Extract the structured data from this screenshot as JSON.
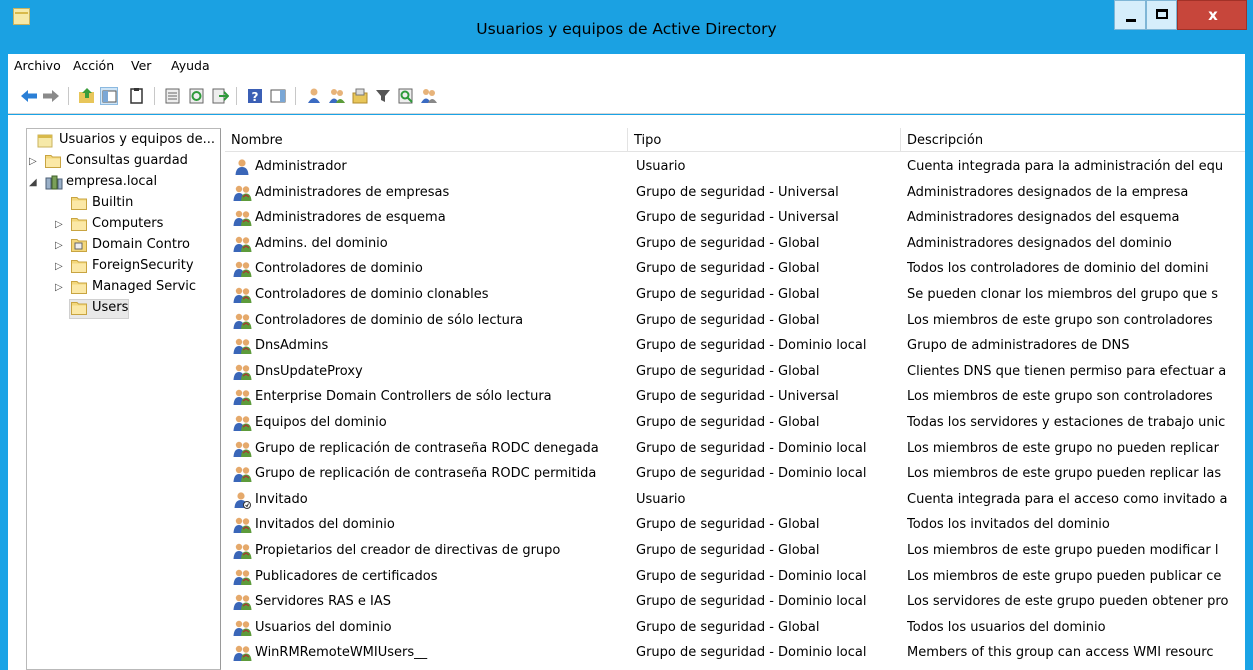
{
  "window": {
    "title": "Usuarios y equipos de Active Directory",
    "close_label": "x"
  },
  "menu": {
    "items": [
      "Archivo",
      "Acción",
      "Ver",
      "Ayuda"
    ]
  },
  "toolbar": {
    "icons": [
      "back-arrow-icon",
      "forward-arrow-icon",
      "up-folder-icon",
      "show-console-tree-icon",
      "clipboard-icon",
      "properties-icon",
      "refresh-icon",
      "export-list-icon",
      "help-icon",
      "show-hide-action-pane-icon",
      "new-user-icon",
      "new-group-icon",
      "new-ou-icon",
      "filter-icon",
      "find-icon",
      "add-to-group-icon"
    ]
  },
  "tree": {
    "root": "Usuarios y equipos de...",
    "items": [
      {
        "label": "Consultas guardad",
        "indent": 0,
        "expander": "collapsed",
        "icon": "folder-icon"
      },
      {
        "label": "empresa.local",
        "indent": 0,
        "expander": "expanded",
        "icon": "domain-icon"
      },
      {
        "label": "Builtin",
        "indent": 1,
        "expander": "none",
        "icon": "folder-icon"
      },
      {
        "label": "Computers",
        "indent": 1,
        "expander": "collapsed",
        "icon": "folder-icon"
      },
      {
        "label": "Domain Contro",
        "indent": 1,
        "expander": "collapsed",
        "icon": "ou-folder-icon"
      },
      {
        "label": "ForeignSecurity",
        "indent": 1,
        "expander": "collapsed",
        "icon": "folder-icon"
      },
      {
        "label": "Managed Servic",
        "indent": 1,
        "expander": "collapsed",
        "icon": "folder-icon"
      },
      {
        "label": "Users",
        "indent": 1,
        "expander": "none",
        "icon": "folder-icon",
        "selected": true
      }
    ]
  },
  "list": {
    "columns": [
      "Nombre",
      "Tipo",
      "Descripción"
    ],
    "rows": [
      {
        "name": "Administrador",
        "type": "Usuario",
        "desc": "Cuenta integrada para la administración del equ",
        "icon": "user-icon"
      },
      {
        "name": "Administradores de empresas",
        "type": "Grupo de seguridad - Universal",
        "desc": "Administradores designados de la empresa",
        "icon": "group-icon"
      },
      {
        "name": "Administradores de esquema",
        "type": "Grupo de seguridad - Universal",
        "desc": "Administradores designados del esquema",
        "icon": "group-icon"
      },
      {
        "name": "Admins. del dominio",
        "type": "Grupo de seguridad - Global",
        "desc": "Administradores designados del dominio",
        "icon": "group-icon"
      },
      {
        "name": "Controladores de dominio",
        "type": "Grupo de seguridad - Global",
        "desc": "Todos los controladores de dominio del domini",
        "icon": "group-icon"
      },
      {
        "name": "Controladores de dominio clonables",
        "type": "Grupo de seguridad - Global",
        "desc": "Se pueden clonar los miembros del grupo que s",
        "icon": "group-icon"
      },
      {
        "name": "Controladores de dominio de sólo lectura",
        "type": "Grupo de seguridad - Global",
        "desc": "Los miembros de este grupo son controladores",
        "icon": "group-icon"
      },
      {
        "name": "DnsAdmins",
        "type": "Grupo de seguridad - Dominio local",
        "desc": "Grupo de administradores de DNS",
        "icon": "group-icon"
      },
      {
        "name": "DnsUpdateProxy",
        "type": "Grupo de seguridad - Global",
        "desc": "Clientes DNS que tienen permiso para efectuar a",
        "icon": "group-icon"
      },
      {
        "name": "Enterprise Domain Controllers de sólo lectura",
        "type": "Grupo de seguridad - Universal",
        "desc": "Los miembros de este grupo son controladores",
        "icon": "group-icon"
      },
      {
        "name": "Equipos del dominio",
        "type": "Grupo de seguridad - Global",
        "desc": "Todas los servidores y estaciones de trabajo unic",
        "icon": "group-icon"
      },
      {
        "name": "Grupo de replicación de contraseña RODC denegada",
        "type": "Grupo de seguridad - Dominio local",
        "desc": "Los miembros de este grupo no pueden replicar",
        "icon": "group-icon"
      },
      {
        "name": "Grupo de replicación de contraseña RODC permitida",
        "type": "Grupo de seguridad - Dominio local",
        "desc": "Los miembros de este grupo pueden replicar las",
        "icon": "group-icon"
      },
      {
        "name": "Invitado",
        "type": "Usuario",
        "desc": "Cuenta integrada para el acceso como invitado a",
        "icon": "disabled-user-icon"
      },
      {
        "name": "Invitados del dominio",
        "type": "Grupo de seguridad - Global",
        "desc": "Todos los invitados del dominio",
        "icon": "group-icon"
      },
      {
        "name": "Propietarios del creador de directivas de grupo",
        "type": "Grupo de seguridad - Global",
        "desc": "Los miembros de este grupo pueden modificar l",
        "icon": "group-icon"
      },
      {
        "name": "Publicadores de certificados",
        "type": "Grupo de seguridad - Dominio local",
        "desc": "Los miembros de este grupo pueden publicar ce",
        "icon": "group-icon"
      },
      {
        "name": "Servidores RAS e IAS",
        "type": "Grupo de seguridad - Dominio local",
        "desc": "Los servidores de este grupo pueden obtener pro",
        "icon": "group-icon"
      },
      {
        "name": "Usuarios del dominio",
        "type": "Grupo de seguridad - Global",
        "desc": "Todos los usuarios del dominio",
        "icon": "group-icon"
      },
      {
        "name": "WinRMRemoteWMIUsers__",
        "type": "Grupo de seguridad - Dominio local",
        "desc": "Members of this group can access WMI resourc",
        "icon": "group-icon"
      }
    ]
  },
  "colors": {
    "title_bar": "#1ba1e2",
    "close_button": "#c7463b"
  }
}
